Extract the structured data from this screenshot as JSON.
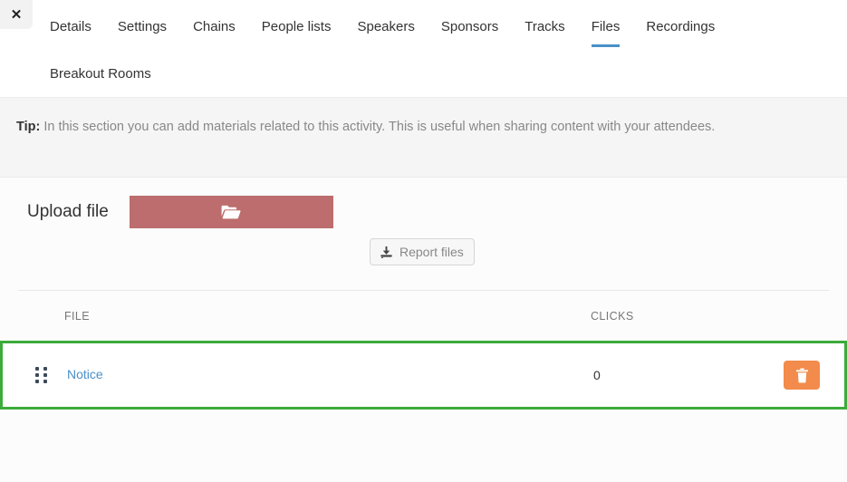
{
  "header": {
    "close_label": "✕",
    "tabs": [
      {
        "label": "Details",
        "active": false
      },
      {
        "label": "Settings",
        "active": false
      },
      {
        "label": "Chains",
        "active": false
      },
      {
        "label": "People lists",
        "active": false
      },
      {
        "label": "Speakers",
        "active": false
      },
      {
        "label": "Sponsors",
        "active": false
      },
      {
        "label": "Tracks",
        "active": false
      },
      {
        "label": "Files",
        "active": true
      },
      {
        "label": "Recordings",
        "active": false
      },
      {
        "label": "Breakout Rooms",
        "active": false
      }
    ]
  },
  "tip": {
    "label": "Tip:",
    "text": " In this section you can add materials related to this activity. This is useful when sharing content with your attendees."
  },
  "upload": {
    "label": "Upload file",
    "button_icon": "folder-open-icon",
    "button_color": "#bd6d6d"
  },
  "report": {
    "label": "Report files",
    "icon": "download-icon"
  },
  "table": {
    "columns": [
      "FILE",
      "CLICKS"
    ],
    "rows": [
      {
        "handle_icon": "drag-handle-icon",
        "file": "Notice",
        "clicks": "0",
        "action_icon": "trash-icon"
      }
    ],
    "highlight_color": "#3cab3c",
    "link_color": "#4a90c8",
    "delete_color": "#f28b4b"
  }
}
